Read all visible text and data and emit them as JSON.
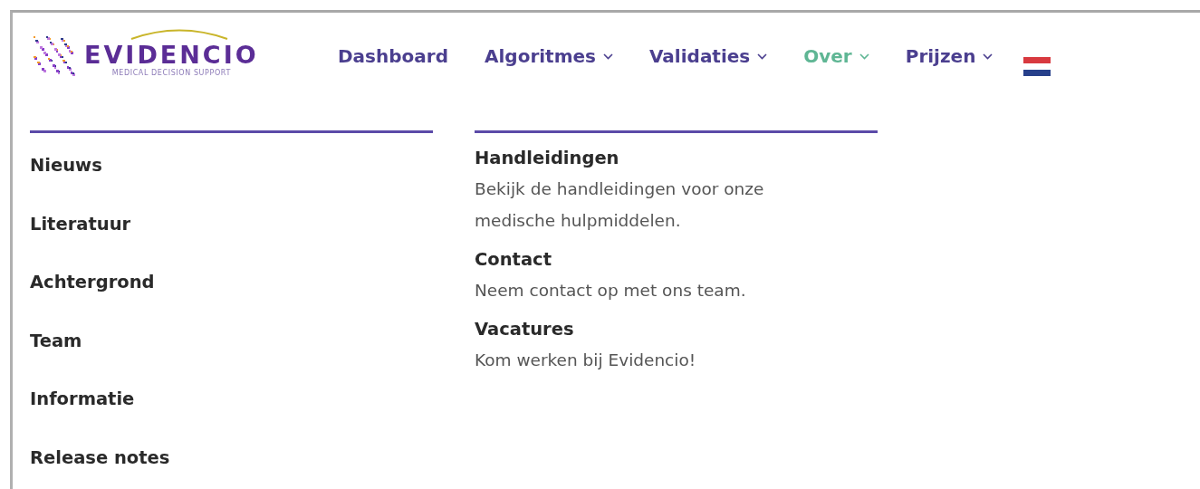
{
  "logo": {
    "name": "EVIDENCIO",
    "tagline": "MEDICAL DECISION SUPPORT"
  },
  "nav": [
    {
      "label": "Dashboard",
      "dropdown": false,
      "selected": false
    },
    {
      "label": "Algoritmes",
      "dropdown": true,
      "selected": false
    },
    {
      "label": "Validaties",
      "dropdown": true,
      "selected": false
    },
    {
      "label": "Over",
      "dropdown": true,
      "selected": true
    },
    {
      "label": "Prijzen",
      "dropdown": true,
      "selected": false
    }
  ],
  "menu_links": [
    "Nieuws",
    "Literatuur",
    "Achtergrond",
    "Team",
    "Informatie",
    "Release notes"
  ],
  "menu_features": [
    {
      "title": "Handleidingen",
      "description": "Bekijk de handleidingen voor onze medische hulpmiddelen."
    },
    {
      "title": "Contact",
      "description": "Neem contact op met ons team."
    },
    {
      "title": "Vacatures",
      "description": "Kom werken bij Evidencio!"
    }
  ]
}
